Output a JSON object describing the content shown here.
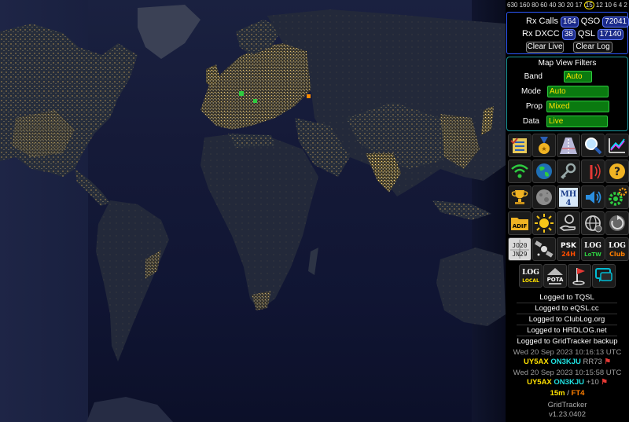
{
  "band_bar": {
    "bands": [
      "630",
      "160",
      "80",
      "60",
      "40",
      "30",
      "20",
      "17",
      "15",
      "12",
      "10",
      "6",
      "4",
      "2"
    ],
    "selected": "15"
  },
  "stats": {
    "rx_calls_label": "Rx Calls",
    "rx_calls_value": "164",
    "qso_label": "QSO",
    "qso_value": "72041",
    "rx_dxcc_label": "Rx DXCC",
    "rx_dxcc_value": "38",
    "qsl_label": "QSL",
    "qsl_value": "17140",
    "clear_live": "Clear Live",
    "clear_log": "Clear Log"
  },
  "filters": {
    "title": "Map View Filters",
    "band_label": "Band",
    "band_value": "Auto",
    "mode_label": "Mode",
    "mode_value": "Auto",
    "prop_label": "Prop",
    "prop_value": "Mixed",
    "data_label": "Data",
    "data_value": "Live"
  },
  "icons": {
    "row5_labels": {
      "jo20": "JO20",
      "jn29": "JN29",
      "psk": "PSK",
      "psk_sub": "24H",
      "lotw": "LOG",
      "lotw_sub": "LoTW",
      "club": "LOG",
      "club_sub": "Club"
    },
    "row6_labels": {
      "local": "LOG",
      "local_sub": "LOCAL",
      "pota": "POTA"
    },
    "mh_label": "MH",
    "mh_num": "4",
    "adif_label": "ADIF"
  },
  "log_lines": [
    "Logged to TQSL",
    "Logged to eQSL.cc",
    "Logged to ClubLog.org",
    "Logged to HRDLOG.net",
    "Logged to GridTracker backup"
  ],
  "decodes": [
    {
      "time": "Wed 20 Sep 2023 10:16:13 UTC",
      "call": "UY5AX",
      "de": "ON3KJU",
      "msg": "RR73"
    },
    {
      "time": "Wed 20 Sep 2023 10:15:58 UTC",
      "call": "UY5AX",
      "de": "ON3KJU",
      "msg": "+10"
    }
  ],
  "band_mode": {
    "band": "15m",
    "sep": "/",
    "mode": "FT4"
  },
  "app": {
    "name": "GridTracker",
    "version": "v1.23.0402"
  },
  "colors": {
    "accent_blue": "#2d58ff",
    "filter_border": "#1a9aa0",
    "select_green": "#0a7a10",
    "select_text": "#ffe100",
    "call_yellow": "#ffe100",
    "de_cyan": "#20e0e0",
    "mode_orange": "#ff7f00"
  }
}
